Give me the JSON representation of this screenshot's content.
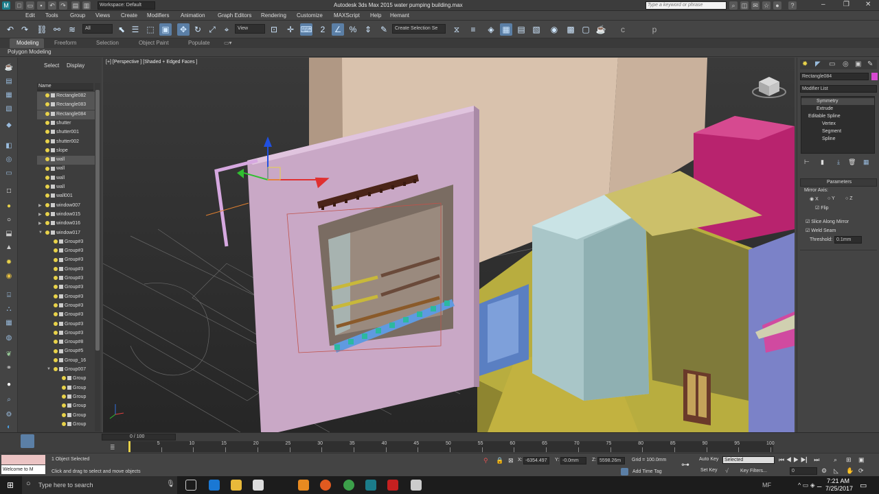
{
  "titlebar": {
    "workspace": "Workspace: Default",
    "title": "Autodesk 3ds Max  2015      water pumping building.max",
    "search_placeholder": "Type a keyword or phrase",
    "user": "Hemant"
  },
  "menubar": {
    "items": [
      "Edit",
      "Tools",
      "Group",
      "Views",
      "Create",
      "Modifiers",
      "Animation",
      "Graph Editors",
      "Rendering",
      "Customize",
      "MAXScript",
      "Help",
      "Hemant"
    ]
  },
  "toolbar": {
    "filter": "All",
    "refcoord": "View",
    "selection_set": "Create Selection Se"
  },
  "ribbon": {
    "tabs": [
      "Modeling",
      "Freeform",
      "Selection",
      "Object Paint",
      "Populate"
    ],
    "subtab": "Polygon Modeling"
  },
  "scene_explorer": {
    "tabs": [
      "Select",
      "Display"
    ],
    "column": "Name",
    "rows": [
      {
        "name": "Rectangle082",
        "sel": true
      },
      {
        "name": "Rectangle083",
        "sel": true
      },
      {
        "name": "Rectangle084",
        "sel": true
      },
      {
        "name": "shutter",
        "sel": false
      },
      {
        "name": "shutter001",
        "sel": false
      },
      {
        "name": "shutter002",
        "sel": false
      },
      {
        "name": "slope",
        "sel": false
      },
      {
        "name": "wall",
        "sel": true
      },
      {
        "name": "wall",
        "sel": false
      },
      {
        "name": "wall",
        "sel": false
      },
      {
        "name": "wall",
        "sel": false
      },
      {
        "name": "wall001",
        "sel": false
      },
      {
        "name": "window007",
        "sel": false
      },
      {
        "name": "window015",
        "sel": false
      },
      {
        "name": "window016",
        "sel": false
      },
      {
        "name": "window017",
        "sel": false
      },
      {
        "name": "Group#3",
        "sel": false
      },
      {
        "name": "Group#3",
        "sel": false
      },
      {
        "name": "Group#3",
        "sel": false
      },
      {
        "name": "Group#3",
        "sel": false
      },
      {
        "name": "Group#3",
        "sel": false
      },
      {
        "name": "Group#3",
        "sel": false
      },
      {
        "name": "Group#3",
        "sel": false
      },
      {
        "name": "Group#3",
        "sel": false
      },
      {
        "name": "Group#3",
        "sel": false
      },
      {
        "name": "Group#3",
        "sel": false
      },
      {
        "name": "Group#3",
        "sel": false
      },
      {
        "name": "Group#8",
        "sel": false
      },
      {
        "name": "Group#5",
        "sel": false
      },
      {
        "name": "Group_16",
        "sel": false
      },
      {
        "name": "Group007",
        "sel": false
      },
      {
        "name": "Group",
        "sel": false
      },
      {
        "name": "Group",
        "sel": false
      },
      {
        "name": "Group",
        "sel": false
      },
      {
        "name": "Group",
        "sel": false
      },
      {
        "name": "Group",
        "sel": false
      },
      {
        "name": "Group",
        "sel": false
      }
    ]
  },
  "viewport": {
    "label": "[+] [Perspective ] [Shaded + Edged Faces ]"
  },
  "command_panel": {
    "object_name": "Rectangle084",
    "modifier_list": "Modifier List",
    "stack": [
      "Symmetry",
      "Extrude",
      "Editable Spline",
      "Vertex",
      "Segment",
      "Spline"
    ],
    "params_title": "Parameters",
    "mirror_axis_label": "Mirror Axis:",
    "axes": [
      "X",
      "Y",
      "Z"
    ],
    "flip": "Flip",
    "slice": "Slice Along Mirror",
    "weld": "Weld Seam",
    "threshold_label": "Threshold:",
    "threshold_value": "0.1mm"
  },
  "timeline": {
    "frame": "0 / 100",
    "ticks": [
      "0",
      "5",
      "10",
      "15",
      "20",
      "25",
      "30",
      "35",
      "40",
      "45",
      "50",
      "55",
      "60",
      "65",
      "70",
      "75",
      "80",
      "85",
      "90",
      "95",
      "100"
    ]
  },
  "status": {
    "maxscript": "Welcome to M",
    "selected": "1 Object Selected",
    "hint": "Click and drag to select and move objects",
    "x_label": "X:",
    "x": "-6354.497",
    "y_label": "Y:",
    "y": "-0.0mm",
    "z_label": "Z:",
    "z": "5598.26m",
    "grid": "Grid = 100.0mm",
    "add_time_tag": "Add Time Tag",
    "auto_key": "Auto Key",
    "set_key": "Set Key",
    "key_selected": "Selected",
    "key_filters": "Key Filters...",
    "frame_field": "0"
  },
  "taskbar": {
    "search_placeholder": "Type here to search",
    "time": "7:21 AM",
    "date": "7/25/2017",
    "lang": "MF"
  }
}
